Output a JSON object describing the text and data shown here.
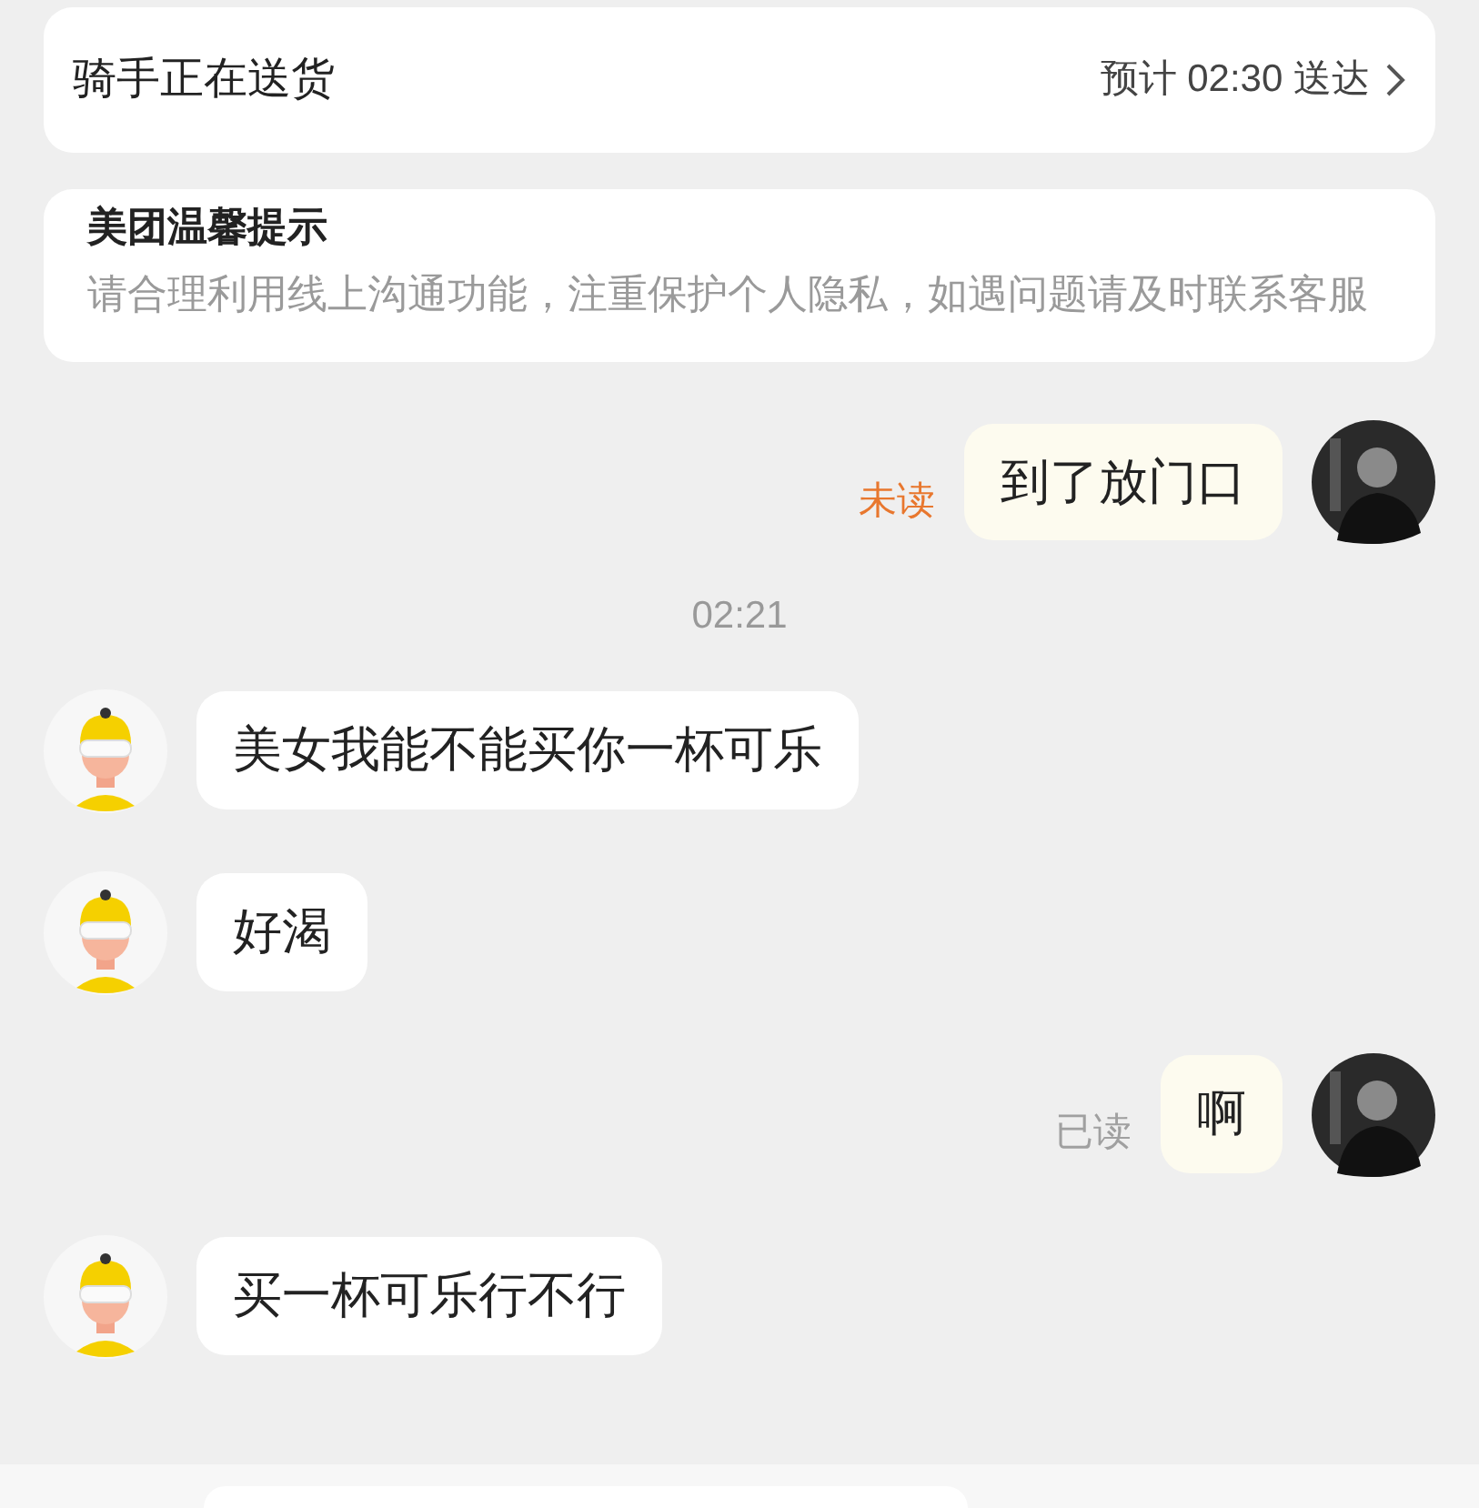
{
  "status_card": {
    "title": "骑手正在送货",
    "eta": "预计 02:30 送达"
  },
  "notice": {
    "title": "美团温馨提示",
    "text": "请合理利用线上沟通功能，注重保护个人隐私，如遇问题请及时联系客服"
  },
  "messages": [
    {
      "kind": "sent",
      "text": "到了放门口",
      "status": {
        "text": "未读",
        "read": false
      }
    },
    {
      "kind": "time",
      "text": "02:21"
    },
    {
      "kind": "received",
      "text": "美女我能不能买你一杯可乐"
    },
    {
      "kind": "received",
      "text": "好渴"
    },
    {
      "kind": "sent",
      "text": "啊",
      "status": {
        "text": "已读",
        "read": true
      }
    },
    {
      "kind": "received",
      "text": "买一杯可乐行不行"
    }
  ]
}
